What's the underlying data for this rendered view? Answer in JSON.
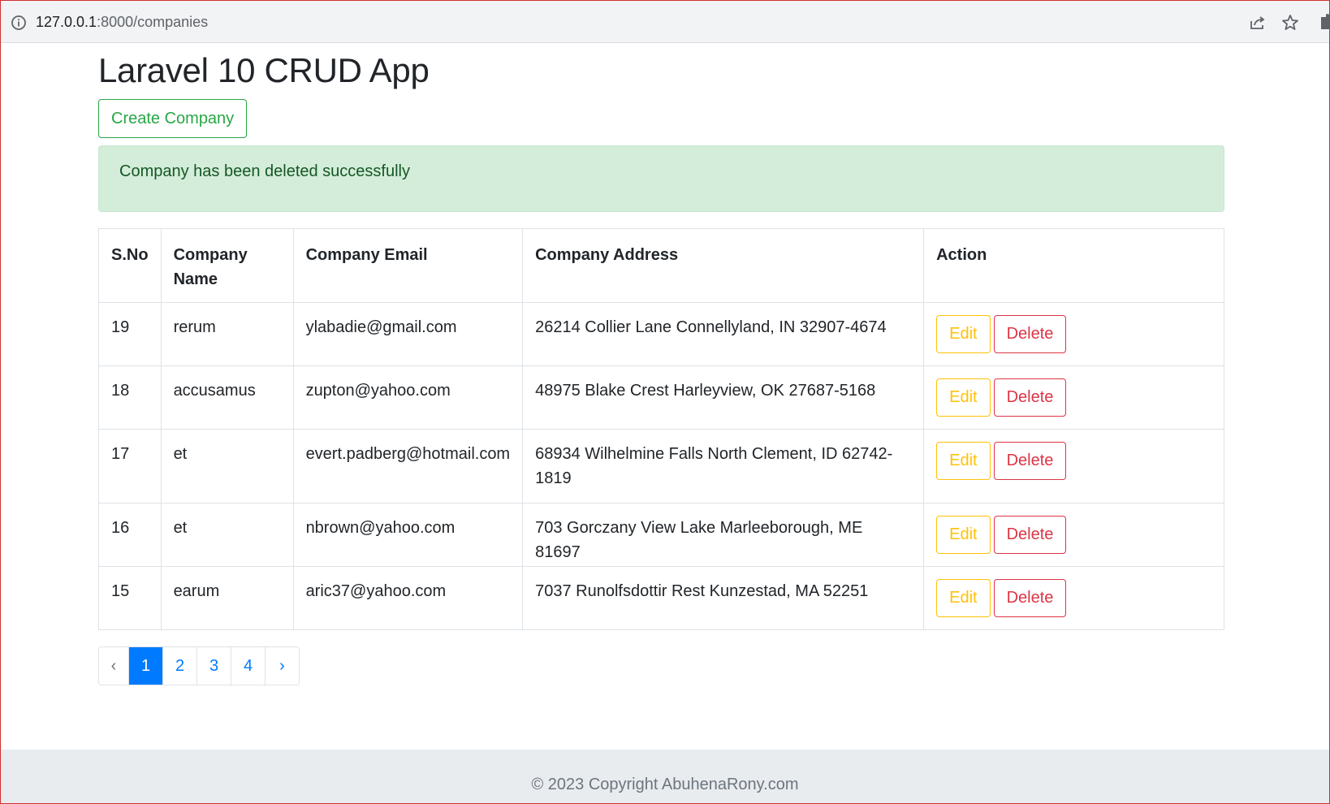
{
  "browser": {
    "url_host": "127.0.0.1",
    "url_path": ":8000/companies"
  },
  "page": {
    "title": "Laravel 10 CRUD App",
    "create_button": "Create Company",
    "alert": "Company has been deleted successfully"
  },
  "table": {
    "headers": [
      "S.No",
      "Company Name",
      "Company Email",
      "Company Address",
      "Action"
    ],
    "rows": [
      {
        "sno": "19",
        "name": "rerum",
        "email": "ylabadie@gmail.com",
        "address": "26214 Collier Lane Connellyland, IN 32907-4674"
      },
      {
        "sno": "18",
        "name": "accusamus",
        "email": "zupton@yahoo.com",
        "address": "48975 Blake Crest Harleyview, OK 27687-5168"
      },
      {
        "sno": "17",
        "name": "et",
        "email": "evert.padberg@hotmail.com",
        "address": "68934 Wilhelmine Falls North Clement, ID 62742-1819"
      },
      {
        "sno": "16",
        "name": "et",
        "email": "nbrown@yahoo.com",
        "address": "703 Gorczany View Lake Marleeborough, ME 81697"
      },
      {
        "sno": "15",
        "name": "earum",
        "email": "aric37@yahoo.com",
        "address": "7037 Runolfsdottir Rest Kunzestad, MA 52251"
      }
    ],
    "edit_label": "Edit",
    "delete_label": "Delete"
  },
  "pagination": {
    "prev": "‹",
    "pages": [
      "1",
      "2",
      "3",
      "4"
    ],
    "active": "1",
    "next": "›"
  },
  "footer": {
    "text": "© 2023 Copyright AbuhenaRony.com"
  },
  "colors": {
    "success": "#28a745",
    "alert_bg": "#d4edda",
    "warning": "#ffc107",
    "danger": "#dc3545",
    "primary": "#007bff"
  }
}
